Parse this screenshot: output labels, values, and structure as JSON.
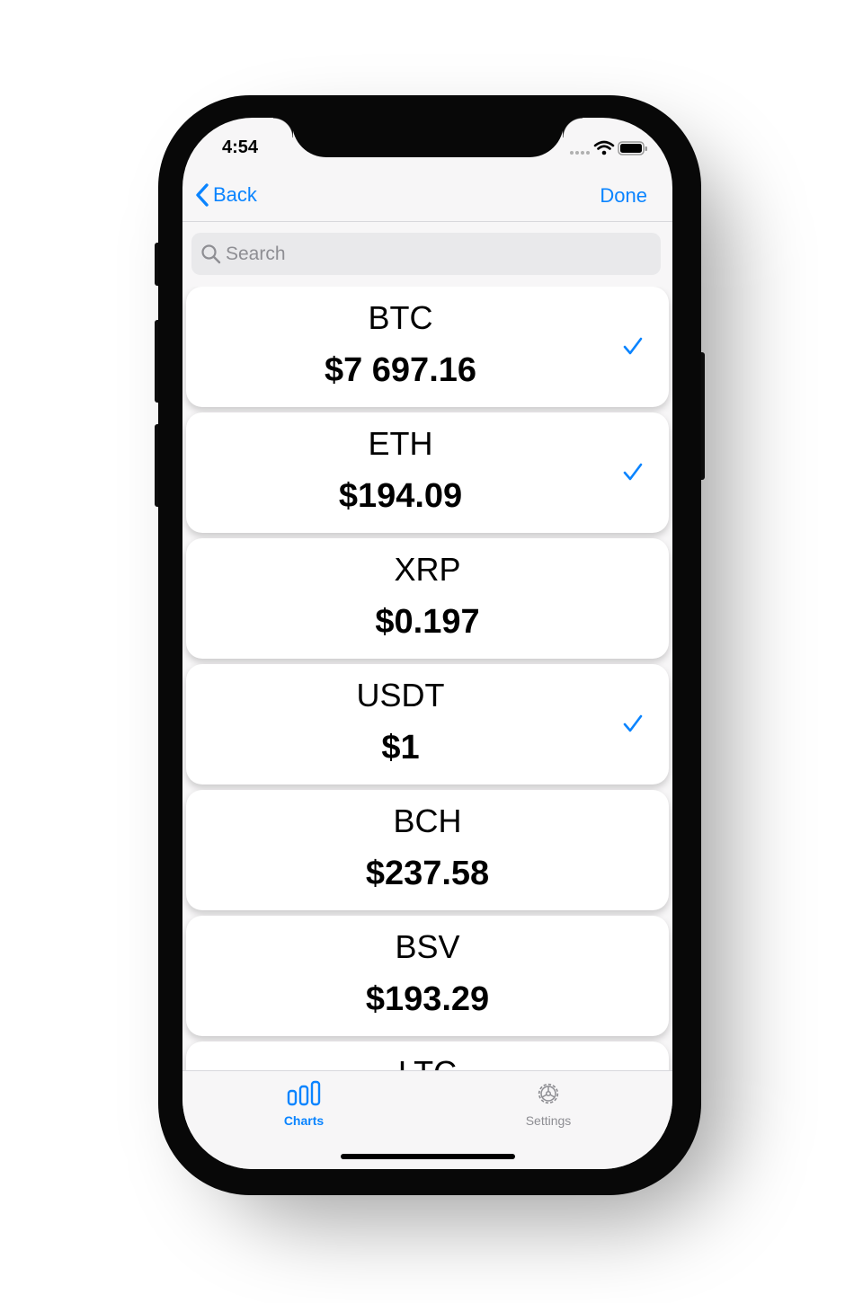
{
  "status_bar": {
    "time": "4:54"
  },
  "nav": {
    "back_label": "Back",
    "done_label": "Done"
  },
  "search": {
    "placeholder": "Search"
  },
  "coins": [
    {
      "symbol": "BTC",
      "price": "$7 697.16",
      "selected": true
    },
    {
      "symbol": "ETH",
      "price": "$194.09",
      "selected": true
    },
    {
      "symbol": "XRP",
      "price": "$0.197",
      "selected": false
    },
    {
      "symbol": "USDT",
      "price": "$1",
      "selected": true
    },
    {
      "symbol": "BCH",
      "price": "$237.58",
      "selected": false
    },
    {
      "symbol": "BSV",
      "price": "$193.29",
      "selected": false
    },
    {
      "symbol": "LTC",
      "price": "",
      "selected": false
    }
  ],
  "tabs": [
    {
      "label": "Charts",
      "icon": "bar-chart-icon",
      "active": true
    },
    {
      "label": "Settings",
      "icon": "gear-icon",
      "active": false
    }
  ],
  "colors": {
    "accent": "#0a84ff",
    "inactive": "#8e8e93",
    "background": "#f7f6f7"
  }
}
